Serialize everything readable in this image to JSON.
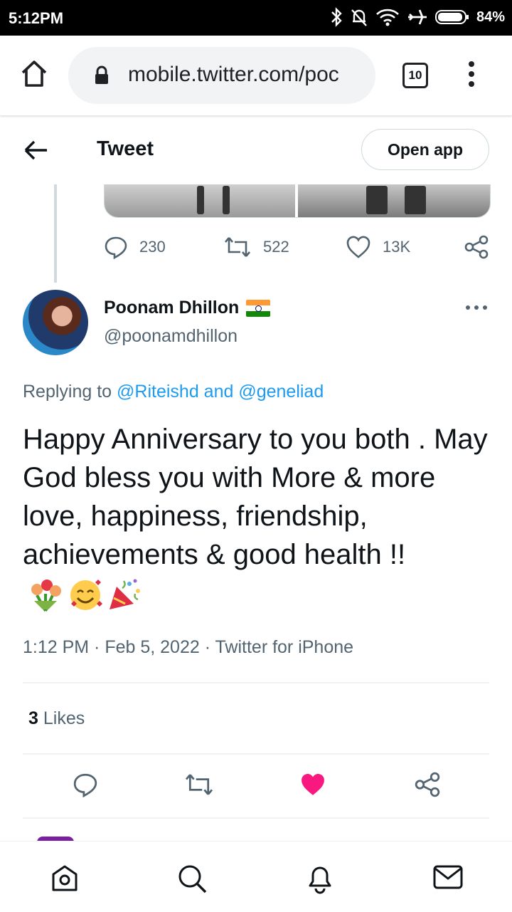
{
  "status_bar": {
    "time": "5:12PM",
    "battery": "84%"
  },
  "browser": {
    "url": "mobile.twitter.com/poc",
    "tab_count": "10"
  },
  "header": {
    "title": "Tweet",
    "open_app_label": "Open app"
  },
  "previous_tweet": {
    "actions": {
      "replies": "230",
      "retweets": "522",
      "likes": "13K"
    }
  },
  "tweet": {
    "author_name": "Poonam Dhillon",
    "author_handle": "@poonamdhillon",
    "replying_prefix": "Replying to",
    "replying_to": "@Riteishd and @geneliad",
    "text": "Happy Anniversary to you both . May God bless you with More & more  love, happiness, friendship, achievements &  good health !!",
    "emojis": [
      "bouquet",
      "smiling-face-with-hearts",
      "party-popper"
    ],
    "meta": "1:12 PM · Feb 5, 2022 · Twitter for iPhone",
    "likes_count": "3",
    "likes_label": "Likes",
    "liked": true
  },
  "colors": {
    "accent": "#1d9bf0",
    "like": "#f91880",
    "text_secondary": "#536471"
  },
  "bottom_nav": [
    "home-icon",
    "search-icon",
    "notifications-icon",
    "messages-icon"
  ]
}
